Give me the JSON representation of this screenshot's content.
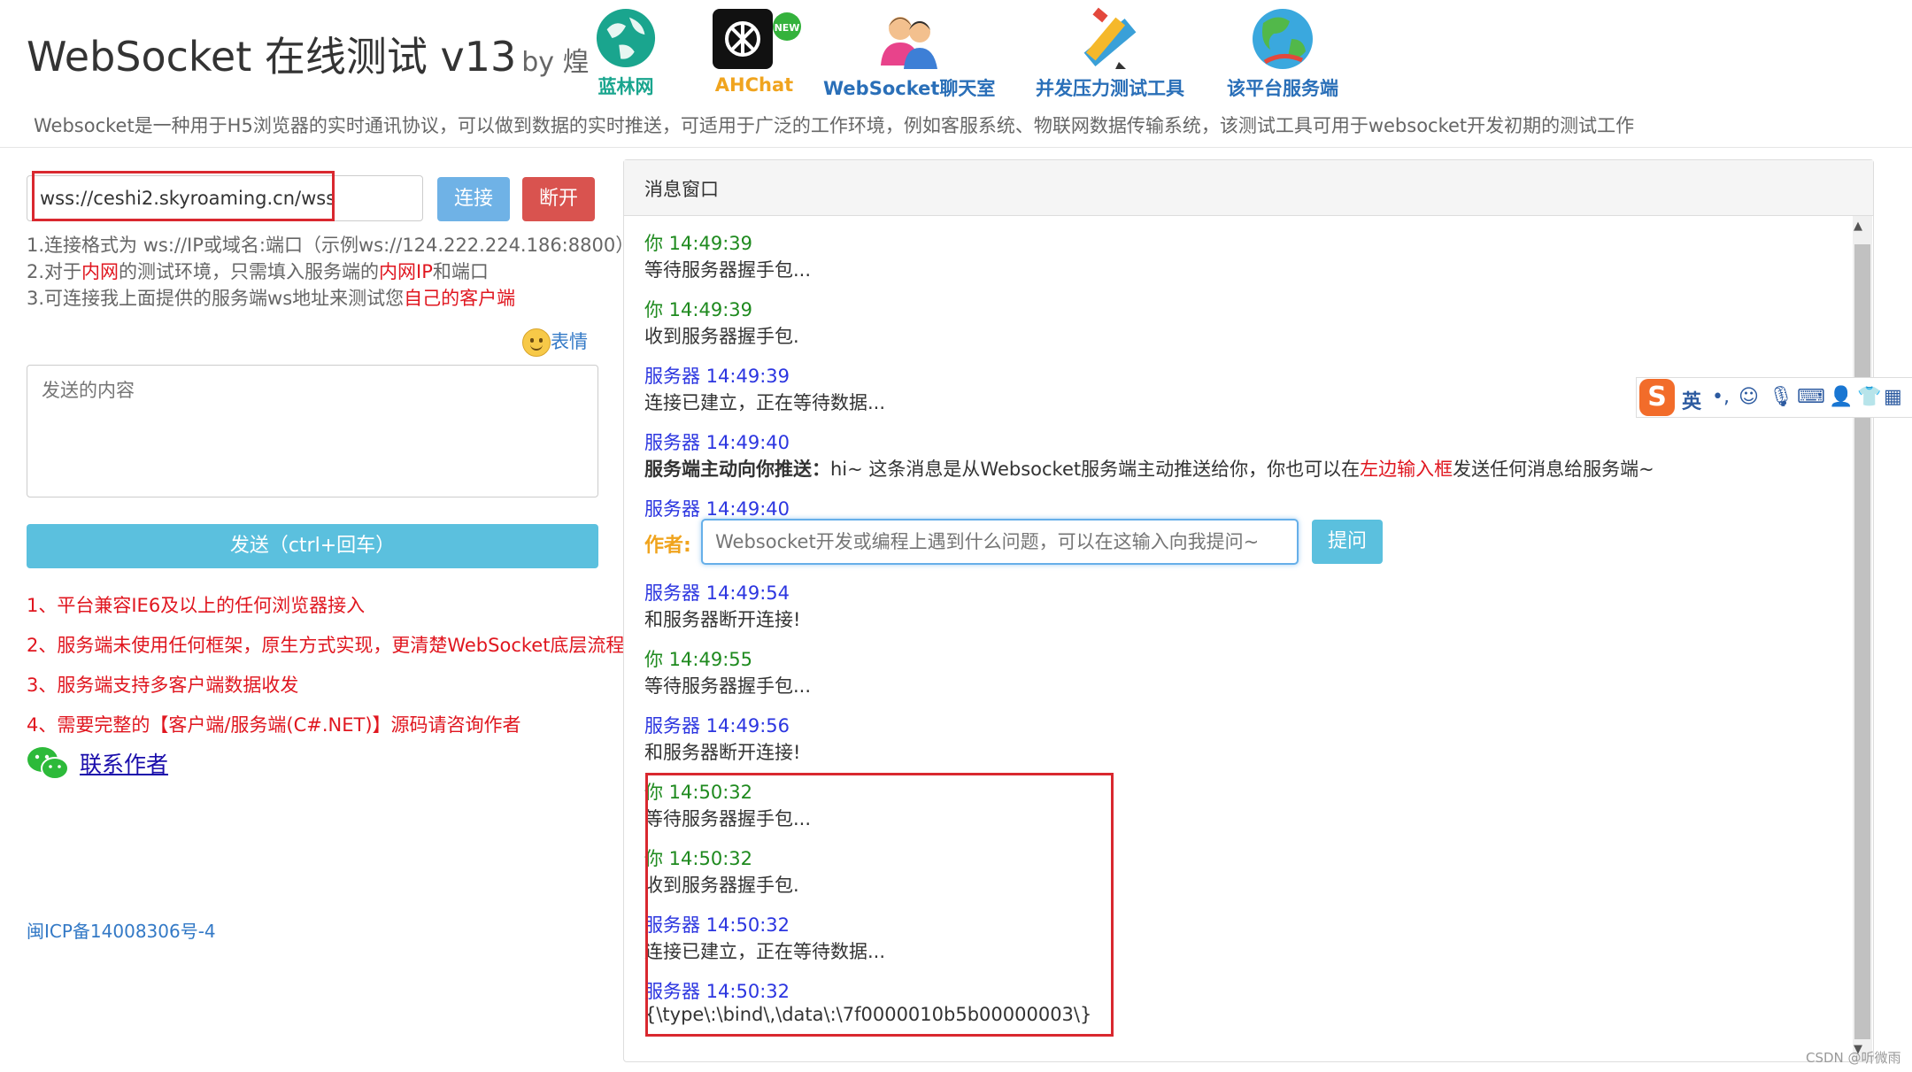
{
  "header": {
    "title": "WebSocket 在线测试 v13",
    "by": "by 煌",
    "nav": [
      {
        "label": "蓝林网",
        "icon": "globe-icon",
        "color": "#19a58e"
      },
      {
        "label": "AHChat",
        "icon": "openai-icon",
        "color": "#f0a41e",
        "badge": "NEW"
      },
      {
        "label": "WebSocket聊天室",
        "icon": "users-icon",
        "color": "#2a6fb8"
      },
      {
        "label": "并发压力测试工具",
        "icon": "pencil-ruler-icon",
        "color": "#2a6fb8"
      },
      {
        "label": "该平台服务端",
        "icon": "earth-icon",
        "color": "#2a6fb8"
      }
    ],
    "description": "Websocket是一种用于H5浏览器的实时通讯协议，可以做到数据的实时推送，可适用于广泛的工作环境，例如客服系统、物联网数据传输系统，该测试工具可用于websocket开发初期的测试工作"
  },
  "left": {
    "url_value": "wss://ceshi2.skyroaming.cn/wss",
    "connect_label": "连接",
    "disconnect_label": "断开",
    "tip1": "1.连接格式为 ws://IP或域名:端口（示例ws://124.222.224.186:8800）",
    "tip2": {
      "a": "2.对于",
      "b": "内网",
      "c": "的测试环境，只需填入服务端的",
      "d": "内网IP",
      "e": "和端口"
    },
    "tip3": {
      "a": "3.可连接我上面提供的服务端ws地址来测试您",
      "b": "自己的客户端"
    },
    "emoji_label": "表情",
    "send_placeholder": "发送的内容",
    "send_label": "发送（ctrl+回车）",
    "notes": [
      "1、平台兼容IE6及以上的任何浏览器接入",
      "2、服务端未使用任何框架，原生方式实现，更清楚WebSocket底层流程",
      "3、服务端支持多客户端数据收发",
      "4、需要完整的【客户端/服务端(C#.NET)】源码请咨询作者"
    ],
    "contact_label": "联系作者",
    "icp": "闽ICP备14008306号-4"
  },
  "panel": {
    "title": "消息窗口",
    "messages": [
      {
        "who": "你 14:49:39",
        "text": "等待服务器握手包..."
      },
      {
        "who": "你 14:49:39",
        "text": "收到服务器握手包."
      },
      {
        "who": "服务器 14:49:39",
        "text": "连接已建立，正在等待数据..."
      },
      {
        "who": "服务器 14:49:40",
        "bold": "服务端主动向你推送：",
        "text": "hi~ 这条消息是从Websocket服务端主动推送给你，你也可以在",
        "red": "左边输入框",
        "tail": "发送任何消息给服务端~"
      },
      {
        "who": "服务器 14:49:40"
      },
      {
        "who": "服务器 14:49:54",
        "text": "和服务器断开连接!"
      },
      {
        "who": "你 14:49:55",
        "text": "等待服务器握手包..."
      },
      {
        "who": "服务器 14:49:56",
        "text": "和服务器断开连接!"
      },
      {
        "who": "你 14:50:32",
        "text": "等待服务器握手包..."
      },
      {
        "who": "你 14:50:32",
        "text": "收到服务器握手包."
      },
      {
        "who": "服务器 14:50:32",
        "text": "连接已建立，正在等待数据..."
      },
      {
        "who": "服务器 14:50:32",
        "text": "{\\type\\:\\bind\\,\\data\\:\\7f0000010b5b00000003\\}"
      }
    ],
    "author_label": "作者:",
    "ask_placeholder": "Websocket开发或编程上遇到什么问题，可以在这输入向我提问~",
    "ask_label": "提问"
  },
  "ime": {
    "logo": "S",
    "mode": "英",
    "punct": "•,"
  },
  "watermark": "CSDN @听微雨"
}
